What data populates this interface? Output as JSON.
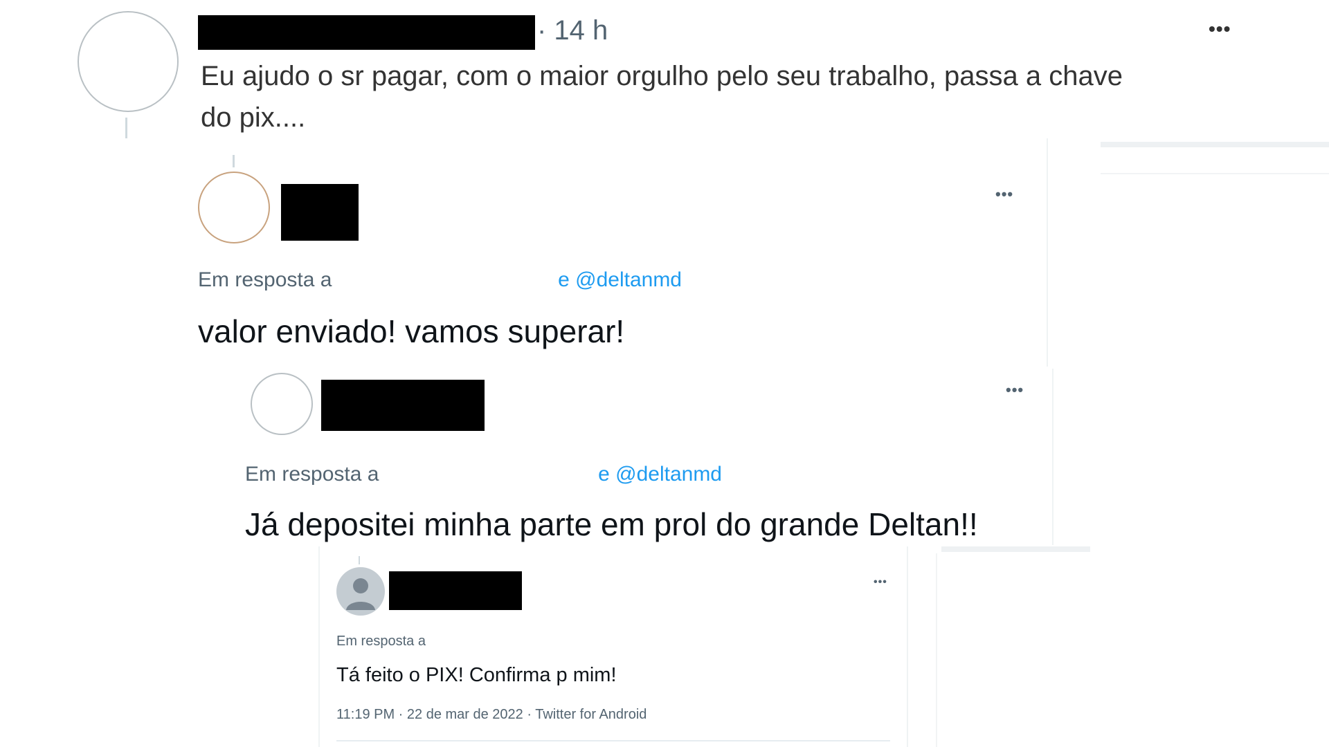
{
  "tweet1": {
    "time": "· 14 h",
    "more_label": "•••",
    "text_line1": "Eu ajudo o sr pagar, com o maior orgulho pelo seu trabalho, passa a chave",
    "text_line2": "do pix...."
  },
  "reply1": {
    "more_label": "•••",
    "reply_to_prefix": "Em resposta a",
    "reply_to_handle": "e @deltanmd",
    "text": "valor enviado! vamos superar!"
  },
  "reply2": {
    "more_label": "•••",
    "reply_to_prefix": "Em resposta a",
    "reply_to_handle": "e @deltanmd",
    "text": "Já depositei minha parte em prol do grande Deltan!!"
  },
  "reply3": {
    "more_label": "•••",
    "reply_to_prefix": "Em resposta a",
    "text": "Tá feito o PIX! Confirma p mim!",
    "meta": "11:19 PM · 22 de mar de 2022 · Twitter for Android"
  },
  "icons": {
    "more": "more-horizontal-icon",
    "default_avatar": "default-profile-icon"
  }
}
